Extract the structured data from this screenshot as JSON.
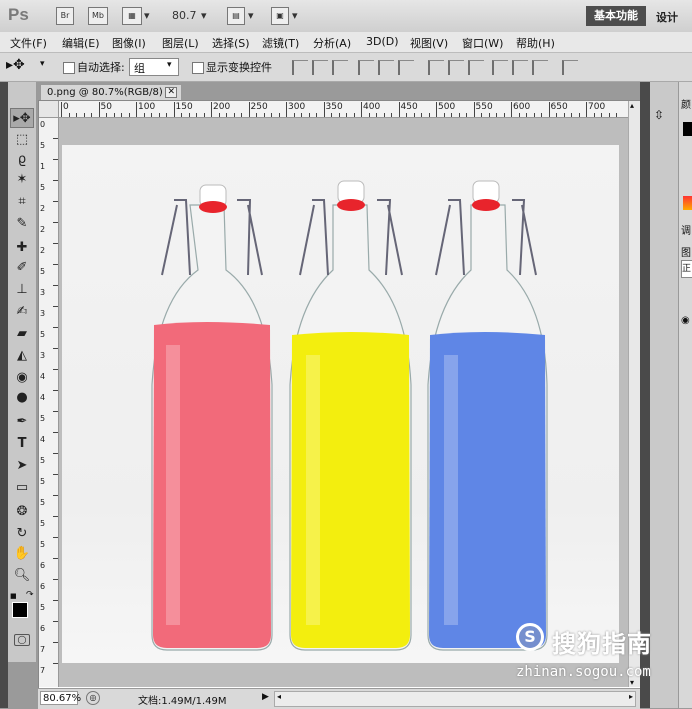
{
  "appbar": {
    "logo": "Ps",
    "btn_bridge": "Br",
    "btn_minibridge": "Mb",
    "zoom_value": "80.7",
    "workspace_active": "基本功能",
    "workspace_design": "设计"
  },
  "menu": [
    "文件(F)",
    "编辑(E)",
    "图像(I)",
    "图层(L)",
    "选择(S)",
    "滤镜(T)",
    "分析(A)",
    "3D(D)",
    "视图(V)",
    "窗口(W)",
    "帮助(H)"
  ],
  "options": {
    "auto_select_label": "自动选择:",
    "auto_select_value": "组",
    "show_transform_label": "显示变换控件"
  },
  "document": {
    "tab_title": "0.png @ 80.7%(RGB/8)",
    "close_glyph": "✕",
    "ruler_top": [
      "0",
      "50",
      "100",
      "150",
      "200",
      "250",
      "300",
      "350",
      "400",
      "450",
      "500",
      "550",
      "600",
      "650",
      "700"
    ],
    "ruler_left": [
      "0",
      "5",
      "1",
      "5",
      "2",
      "2",
      "2",
      "5",
      "3",
      "3",
      "5",
      "3",
      "4",
      "4",
      "5",
      "4",
      "5",
      "5",
      "5",
      "5",
      "5",
      "6",
      "6",
      "5",
      "6",
      "7",
      "7"
    ]
  },
  "status": {
    "zoom": "80.67%",
    "doc_info": "文档:1.49M/1.49M"
  },
  "rightpanel": {
    "tab1": "颜",
    "tab2": "调",
    "tab3": "图",
    "tab4": "正"
  },
  "watermark": {
    "logo_letter": "S",
    "text": "搜狗指南",
    "url": "zhinan.sogou.com"
  },
  "colors": {
    "bottle_red": "#f26a7a",
    "bottle_yellow": "#f3ee0e",
    "bottle_blue": "#5f86e6",
    "cap": "#e8242c"
  }
}
